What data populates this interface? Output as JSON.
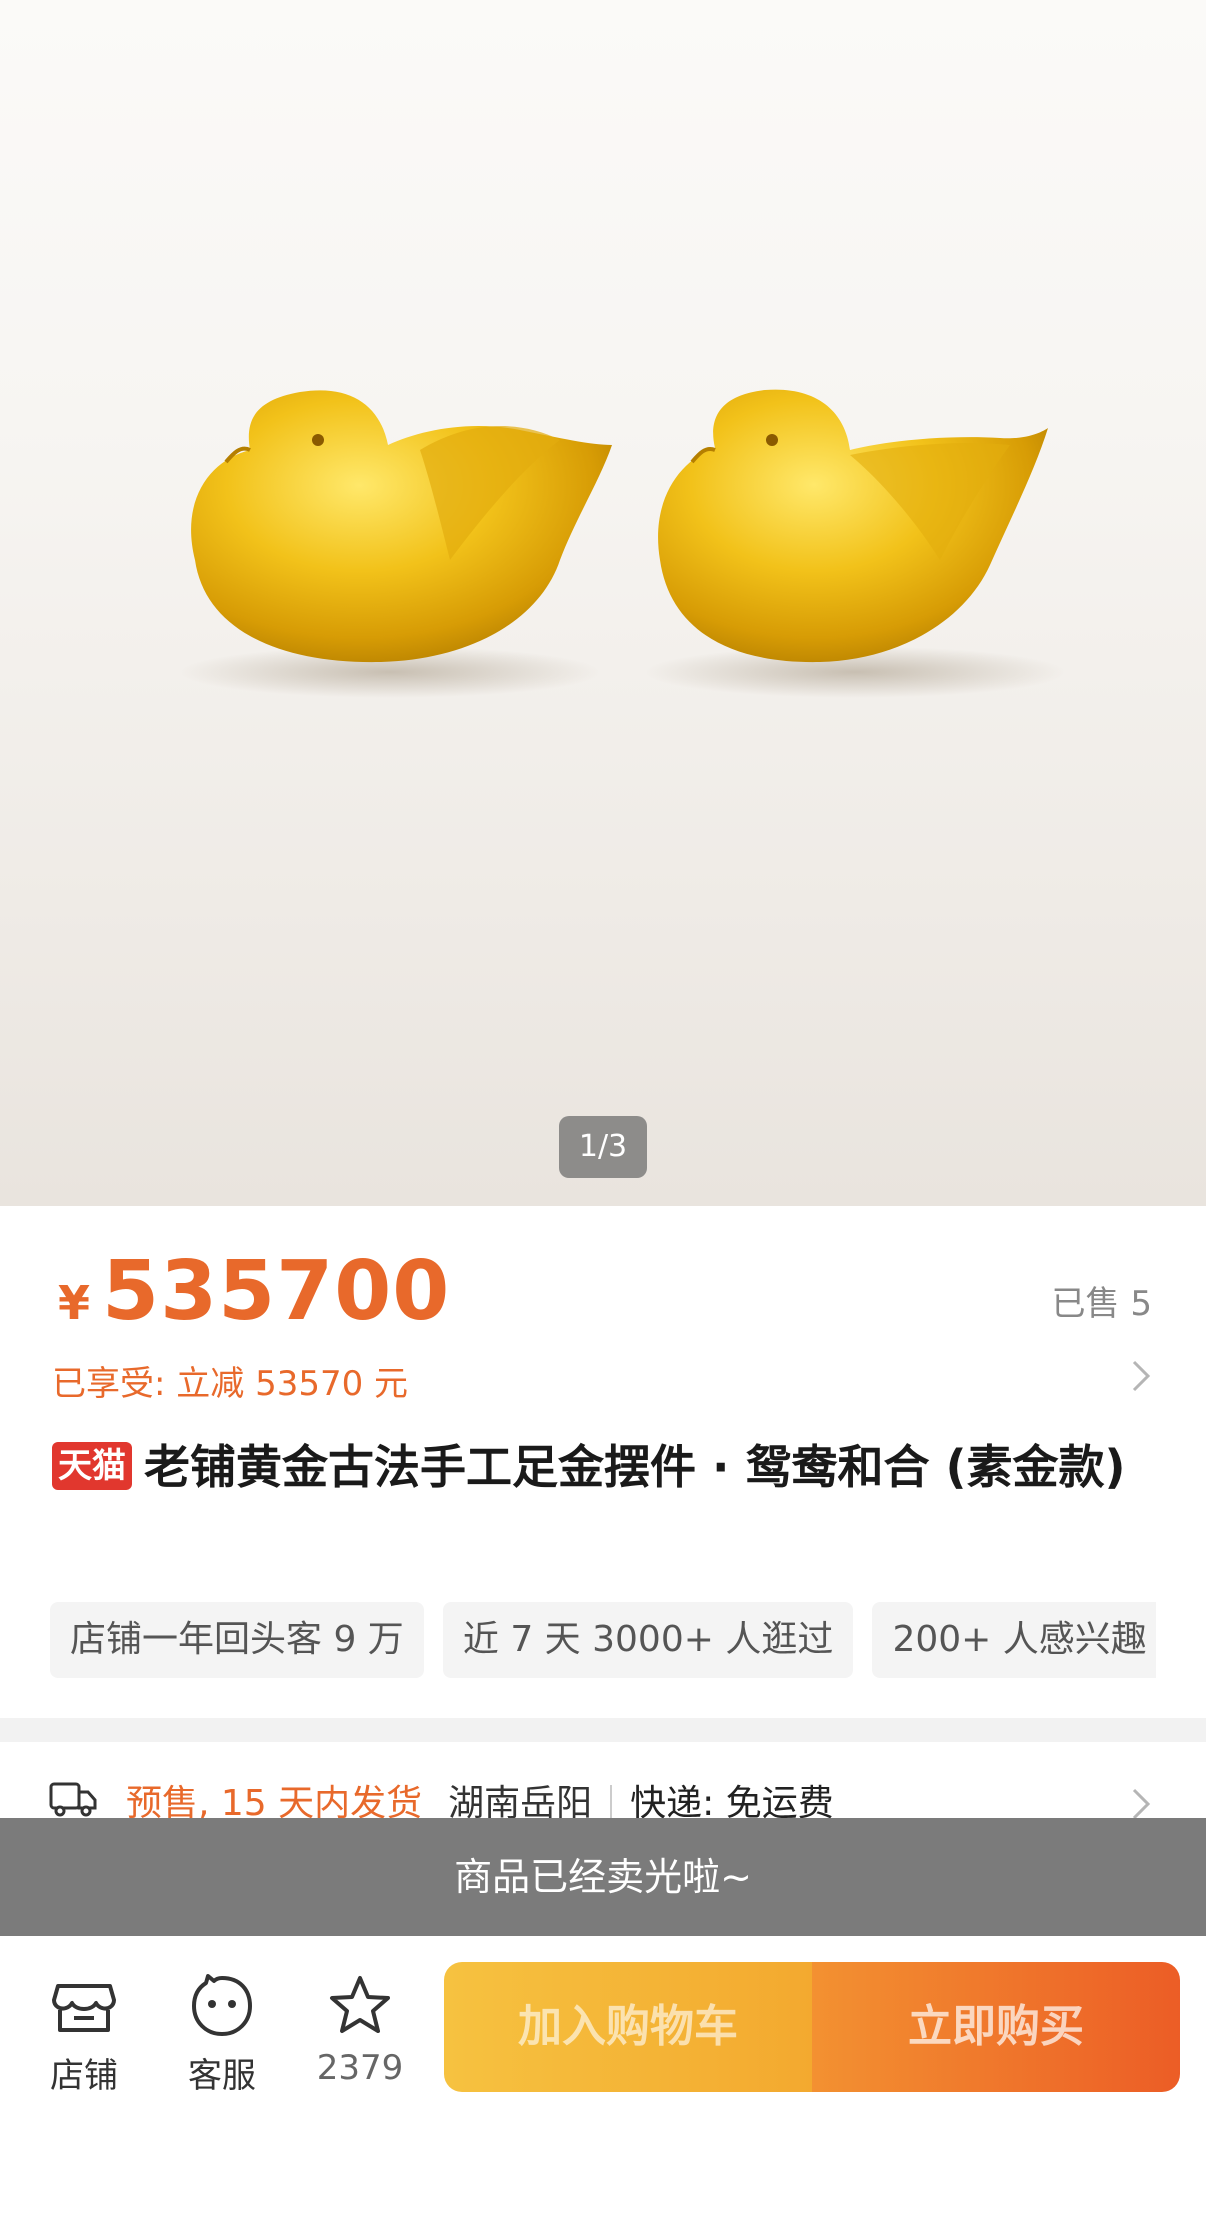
{
  "gallery": {
    "counter": "1/3",
    "image_description_icon": "golden-mandarin-ducks-image"
  },
  "price": {
    "symbol": "¥",
    "amount": "535700",
    "sold": "已售 5",
    "promo": "已享受: 立减 53570 元"
  },
  "product": {
    "badge": "天猫",
    "title": "老铺黄金古法手工足金摆件 · 鸳鸯和合 (素金款)"
  },
  "tags": [
    "店铺一年回头客 9 万",
    "近 7 天 3000+ 人逛过",
    "200+ 人感兴趣"
  ],
  "shipping": {
    "presale": "预售, 15 天内发货",
    "location": "湖南岳阳",
    "delivery": "快递: 免运费"
  },
  "soldout_banner": "商品已经卖光啦~",
  "bottom_bar": {
    "store_label": "店铺",
    "service_label": "客服",
    "favorites_count": "2379",
    "cart_label": "加入购物车",
    "buy_label": "立即购买"
  },
  "colors": {
    "accent": "#e8692b",
    "tmall_red": "#e1372e",
    "cart_button": "#f3b338",
    "buy_button": "#ec5d26"
  }
}
